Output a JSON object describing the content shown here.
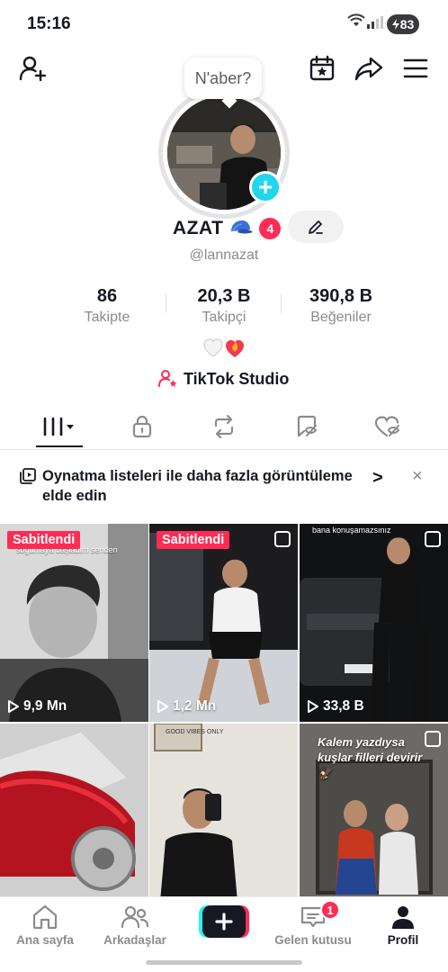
{
  "status": {
    "time": "15:16",
    "battery": "83"
  },
  "profile": {
    "bubble": "N'aber?",
    "name": "AZAT",
    "badge_count": "4",
    "handle": "@lannazat",
    "bio_emoji": "🤍❤️‍🔥",
    "studio_label": "TikTok Studio"
  },
  "stats": [
    {
      "value": "86",
      "label": "Takipte"
    },
    {
      "value": "20,3 B",
      "label": "Takipçi"
    },
    {
      "value": "390,8 B",
      "label": "Beğeniler"
    }
  ],
  "tabs": [
    {
      "name": "videos",
      "icon": "grid-icon",
      "active": true
    },
    {
      "name": "private",
      "icon": "lock-icon"
    },
    {
      "name": "reposts",
      "icon": "repost-icon"
    },
    {
      "name": "favorites",
      "icon": "bookmark-icon"
    },
    {
      "name": "liked",
      "icon": "heart-icon"
    }
  ],
  "banner": {
    "text": "Oynatma listeleri ile daha fazla görüntüleme elde edin",
    "chevron": ">",
    "close": "×"
  },
  "videos": [
    {
      "pinned": "Sabitlendi",
      "views": "9,9 Mn",
      "caption": "soğumaya başladım senden"
    },
    {
      "pinned": "Sabitlendi",
      "views": "1,2 Mn"
    },
    {
      "views": "33,8 B",
      "caption": "bana konuşamazsınız"
    },
    {},
    {
      "caption": "GOOD VIBES ONLY"
    },
    {
      "caption": "Kalem yazdıysa kuşlar filleri devirir 🦅"
    }
  ],
  "nav": {
    "home": "Ana sayfa",
    "friends": "Arkadaşlar",
    "inbox": "Gelen kutusu",
    "inbox_badge": "1",
    "profile": "Profil"
  },
  "colors": {
    "accent": "#fe2c55",
    "cyan": "#20d5ec",
    "text": "#161823",
    "muted": "#8a8b91"
  }
}
